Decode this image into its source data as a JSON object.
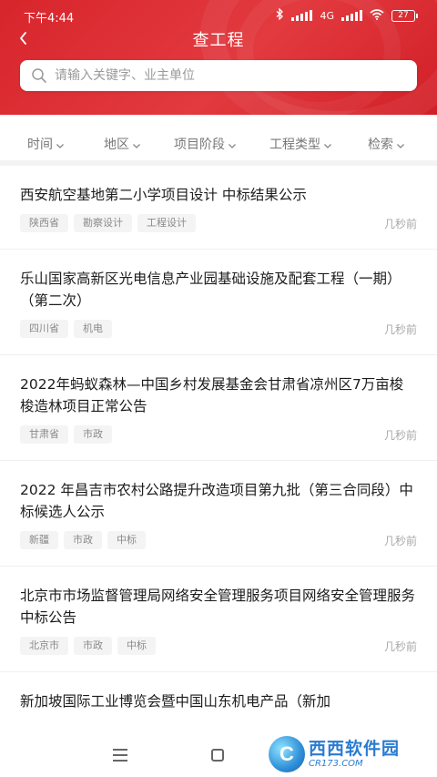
{
  "status_bar": {
    "time": "下午4:44",
    "network": "4G",
    "battery": "27"
  },
  "header": {
    "title": "查工程",
    "back_icon": "chevron-left-icon"
  },
  "search": {
    "placeholder": "请输入关键字、业主单位",
    "value": ""
  },
  "filters": [
    {
      "label": "时间"
    },
    {
      "label": "地区"
    },
    {
      "label": "项目阶段"
    },
    {
      "label": "工程类型"
    },
    {
      "label": "检索"
    }
  ],
  "items": [
    {
      "title": "西安航空基地第二小学项目设计 中标结果公示",
      "tags": [
        "陕西省",
        "勘察设计",
        "工程设计"
      ],
      "time": "几秒前"
    },
    {
      "title": "乐山国家高新区光电信息产业园基础设施及配套工程（一期）（第二次）",
      "tags": [
        "四川省",
        "机电"
      ],
      "time": "几秒前"
    },
    {
      "title": "2022年蚂蚁森林—中国乡村发展基金会甘肃省凉州区7万亩梭梭造林项目正常公告",
      "tags": [
        "甘肃省",
        "市政"
      ],
      "time": "几秒前"
    },
    {
      "title": "2022 年昌吉市农村公路提升改造项目第九批（第三合同段）中标候选人公示",
      "tags": [
        "新疆",
        "市政",
        "中标"
      ],
      "time": "几秒前"
    },
    {
      "title": "北京市市场监督管理局网络安全管理服务项目网络安全管理服务中标公告",
      "tags": [
        "北京市",
        "市政",
        "中标"
      ],
      "time": "几秒前"
    },
    {
      "title": "新加坡国际工业博览会暨中国山东机电产品（新加",
      "tags": [],
      "time": ""
    }
  ],
  "watermark": {
    "logo_letter": "C",
    "name": "西西软件园",
    "url": "CR173.COM"
  },
  "colors": {
    "header_red": "#d8252c",
    "text": "#1c1c1c",
    "muted": "#a8a8a8"
  }
}
